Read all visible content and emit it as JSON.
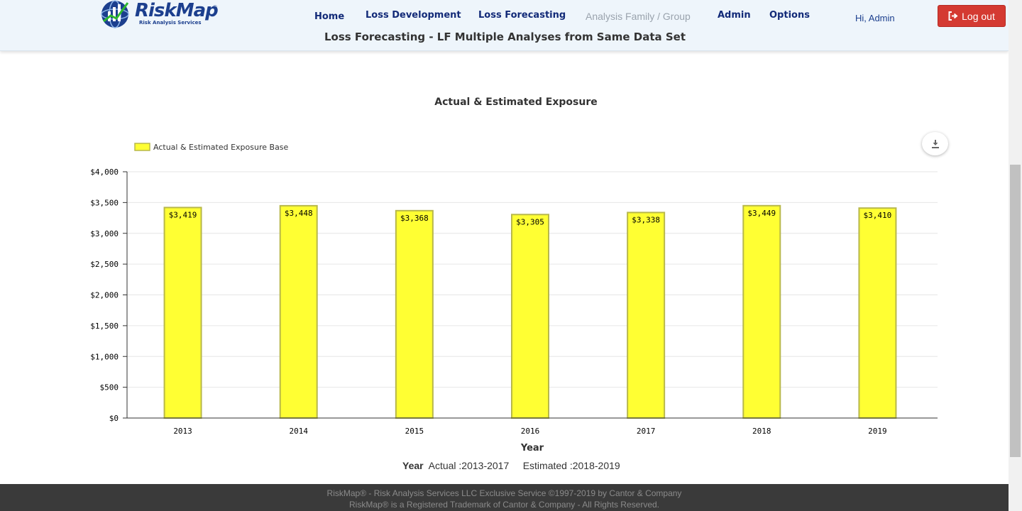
{
  "header": {
    "logo_text": "RiskMap",
    "logo_reg": "®",
    "logo_sub": "Risk Analysis Services",
    "nav": [
      {
        "label": "Home"
      },
      {
        "label": "Loss Development"
      },
      {
        "label": "Loss Forecasting"
      },
      {
        "label": "Analysis Family / Group",
        "disabled": true
      },
      {
        "label": "Admin"
      },
      {
        "label": "Options"
      }
    ],
    "greeting": "Hi, Admin",
    "logout_label": "Log out",
    "page_title": "Loss Forecasting - LF Multiple Analyses from Same Data Set"
  },
  "summary": {
    "year_label": "Year",
    "actual": "Actual :2013-2017",
    "estimated": "Estimated :2018-2019"
  },
  "footer": {
    "line1": "RiskMap® - Risk Analysis Services LLC Exclusive Service ©1997-2019 by Cantor & Company",
    "line2": "RiskMap® is a Registered Trademark of Cantor & Company - All Rights Reserved."
  },
  "colors": {
    "bar_fill": "#ffff33",
    "bar_stroke": "#b8b84a",
    "nav": "#122a78",
    "logout": "#d43a32"
  },
  "icons": {
    "export": "download-icon",
    "logout": "sign-out-icon"
  },
  "chart_data": {
    "type": "bar",
    "title": "Actual & Estimated Exposure",
    "xlabel": "Year",
    "ylabel": "",
    "categories": [
      "2013",
      "2014",
      "2015",
      "2016",
      "2017",
      "2018",
      "2019"
    ],
    "series": [
      {
        "name": "Actual & Estimated Exposure Base",
        "values": [
          3419,
          3448,
          3368,
          3305,
          3338,
          3449,
          3410
        ],
        "labels": [
          "$3,419",
          "$3,448",
          "$3,368",
          "$3,305",
          "$3,338",
          "$3,449",
          "$3,410"
        ]
      }
    ],
    "ylim": [
      0,
      4000
    ],
    "yticks": [
      "$0",
      "$500",
      "$1,000",
      "$1,500",
      "$2,000",
      "$2,500",
      "$3,000",
      "$3,500",
      "$4,000"
    ],
    "ytick_values": [
      0,
      500,
      1000,
      1500,
      2000,
      2500,
      3000,
      3500,
      4000
    ],
    "grid": true,
    "legend": "top-left"
  }
}
